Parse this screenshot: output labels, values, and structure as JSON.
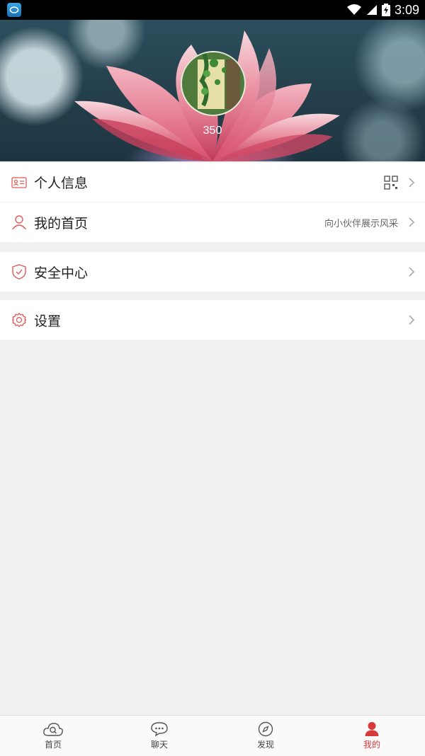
{
  "status_bar": {
    "time": "3:09"
  },
  "header": {
    "score": "350"
  },
  "menu": {
    "profile_info": {
      "label": "个人信息",
      "icon": "id-card-icon",
      "right_icon": "qr-code-icon"
    },
    "my_homepage": {
      "label": "我的首页",
      "subtitle": "向小伙伴展示风采",
      "icon": "user-icon"
    },
    "security_center": {
      "label": "安全中心",
      "icon": "shield-icon"
    },
    "settings": {
      "label": "设置",
      "icon": "gear-icon"
    }
  },
  "tabs": [
    {
      "label": "首页",
      "icon": "cloud-search-icon",
      "active": false
    },
    {
      "label": "聊天",
      "icon": "chat-bubble-icon",
      "active": false
    },
    {
      "label": "发现",
      "icon": "compass-icon",
      "active": false
    },
    {
      "label": "我的",
      "icon": "person-icon",
      "active": true
    }
  ],
  "colors": {
    "accent": "#d63a3a",
    "background": "#f1f1f1",
    "icon_red": "#e05a5a"
  }
}
